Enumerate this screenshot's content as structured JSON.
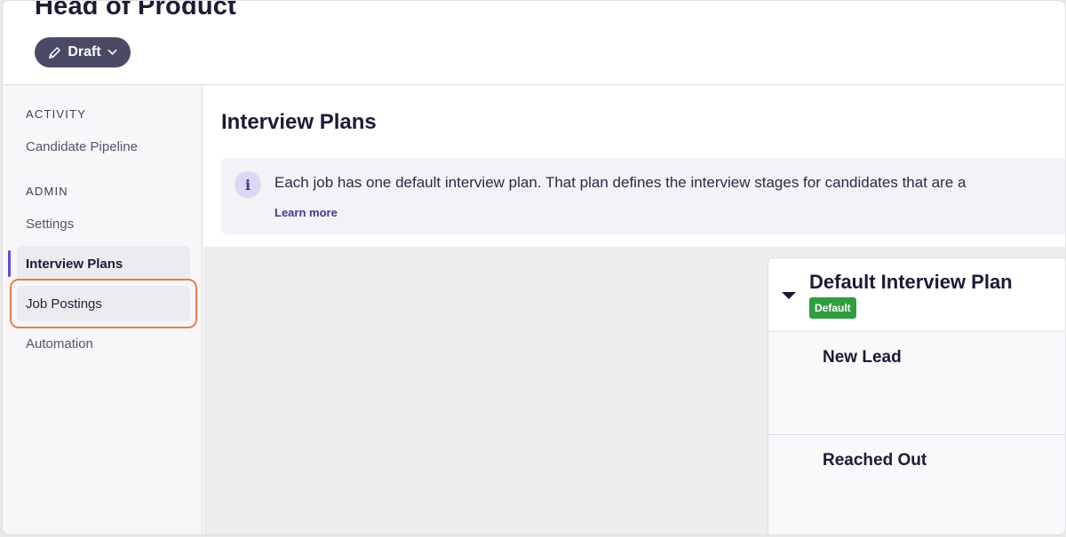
{
  "header": {
    "job_title": "Head of Product",
    "status": "Draft"
  },
  "sidebar": {
    "sections": [
      {
        "heading": "ACTIVITY",
        "items": [
          {
            "label": "Candidate Pipeline"
          }
        ]
      },
      {
        "heading": "ADMIN",
        "items": [
          {
            "label": "Settings"
          },
          {
            "label": "Interview Plans",
            "active": true
          },
          {
            "label": "Job Postings",
            "highlighted": true
          },
          {
            "label": "Automation"
          }
        ]
      }
    ],
    "accent_color": "#5b4fd6",
    "highlight_color": "#f07b3f"
  },
  "main": {
    "title": "Interview Plans",
    "info": {
      "text": "Each job has one default interview plan. That plan defines the interview stages for candidates that are a",
      "link": "Learn more"
    },
    "plan": {
      "title": "Default Interview Plan",
      "badge": "Default",
      "badge_color": "#2f9e3f",
      "stages": [
        "New Lead",
        "Reached Out"
      ]
    }
  },
  "icons": {
    "status_pill": [
      "pencil-icon",
      "chevron-down-icon"
    ],
    "info": "info-icon",
    "plan_toggle": "caret-down-icon"
  }
}
